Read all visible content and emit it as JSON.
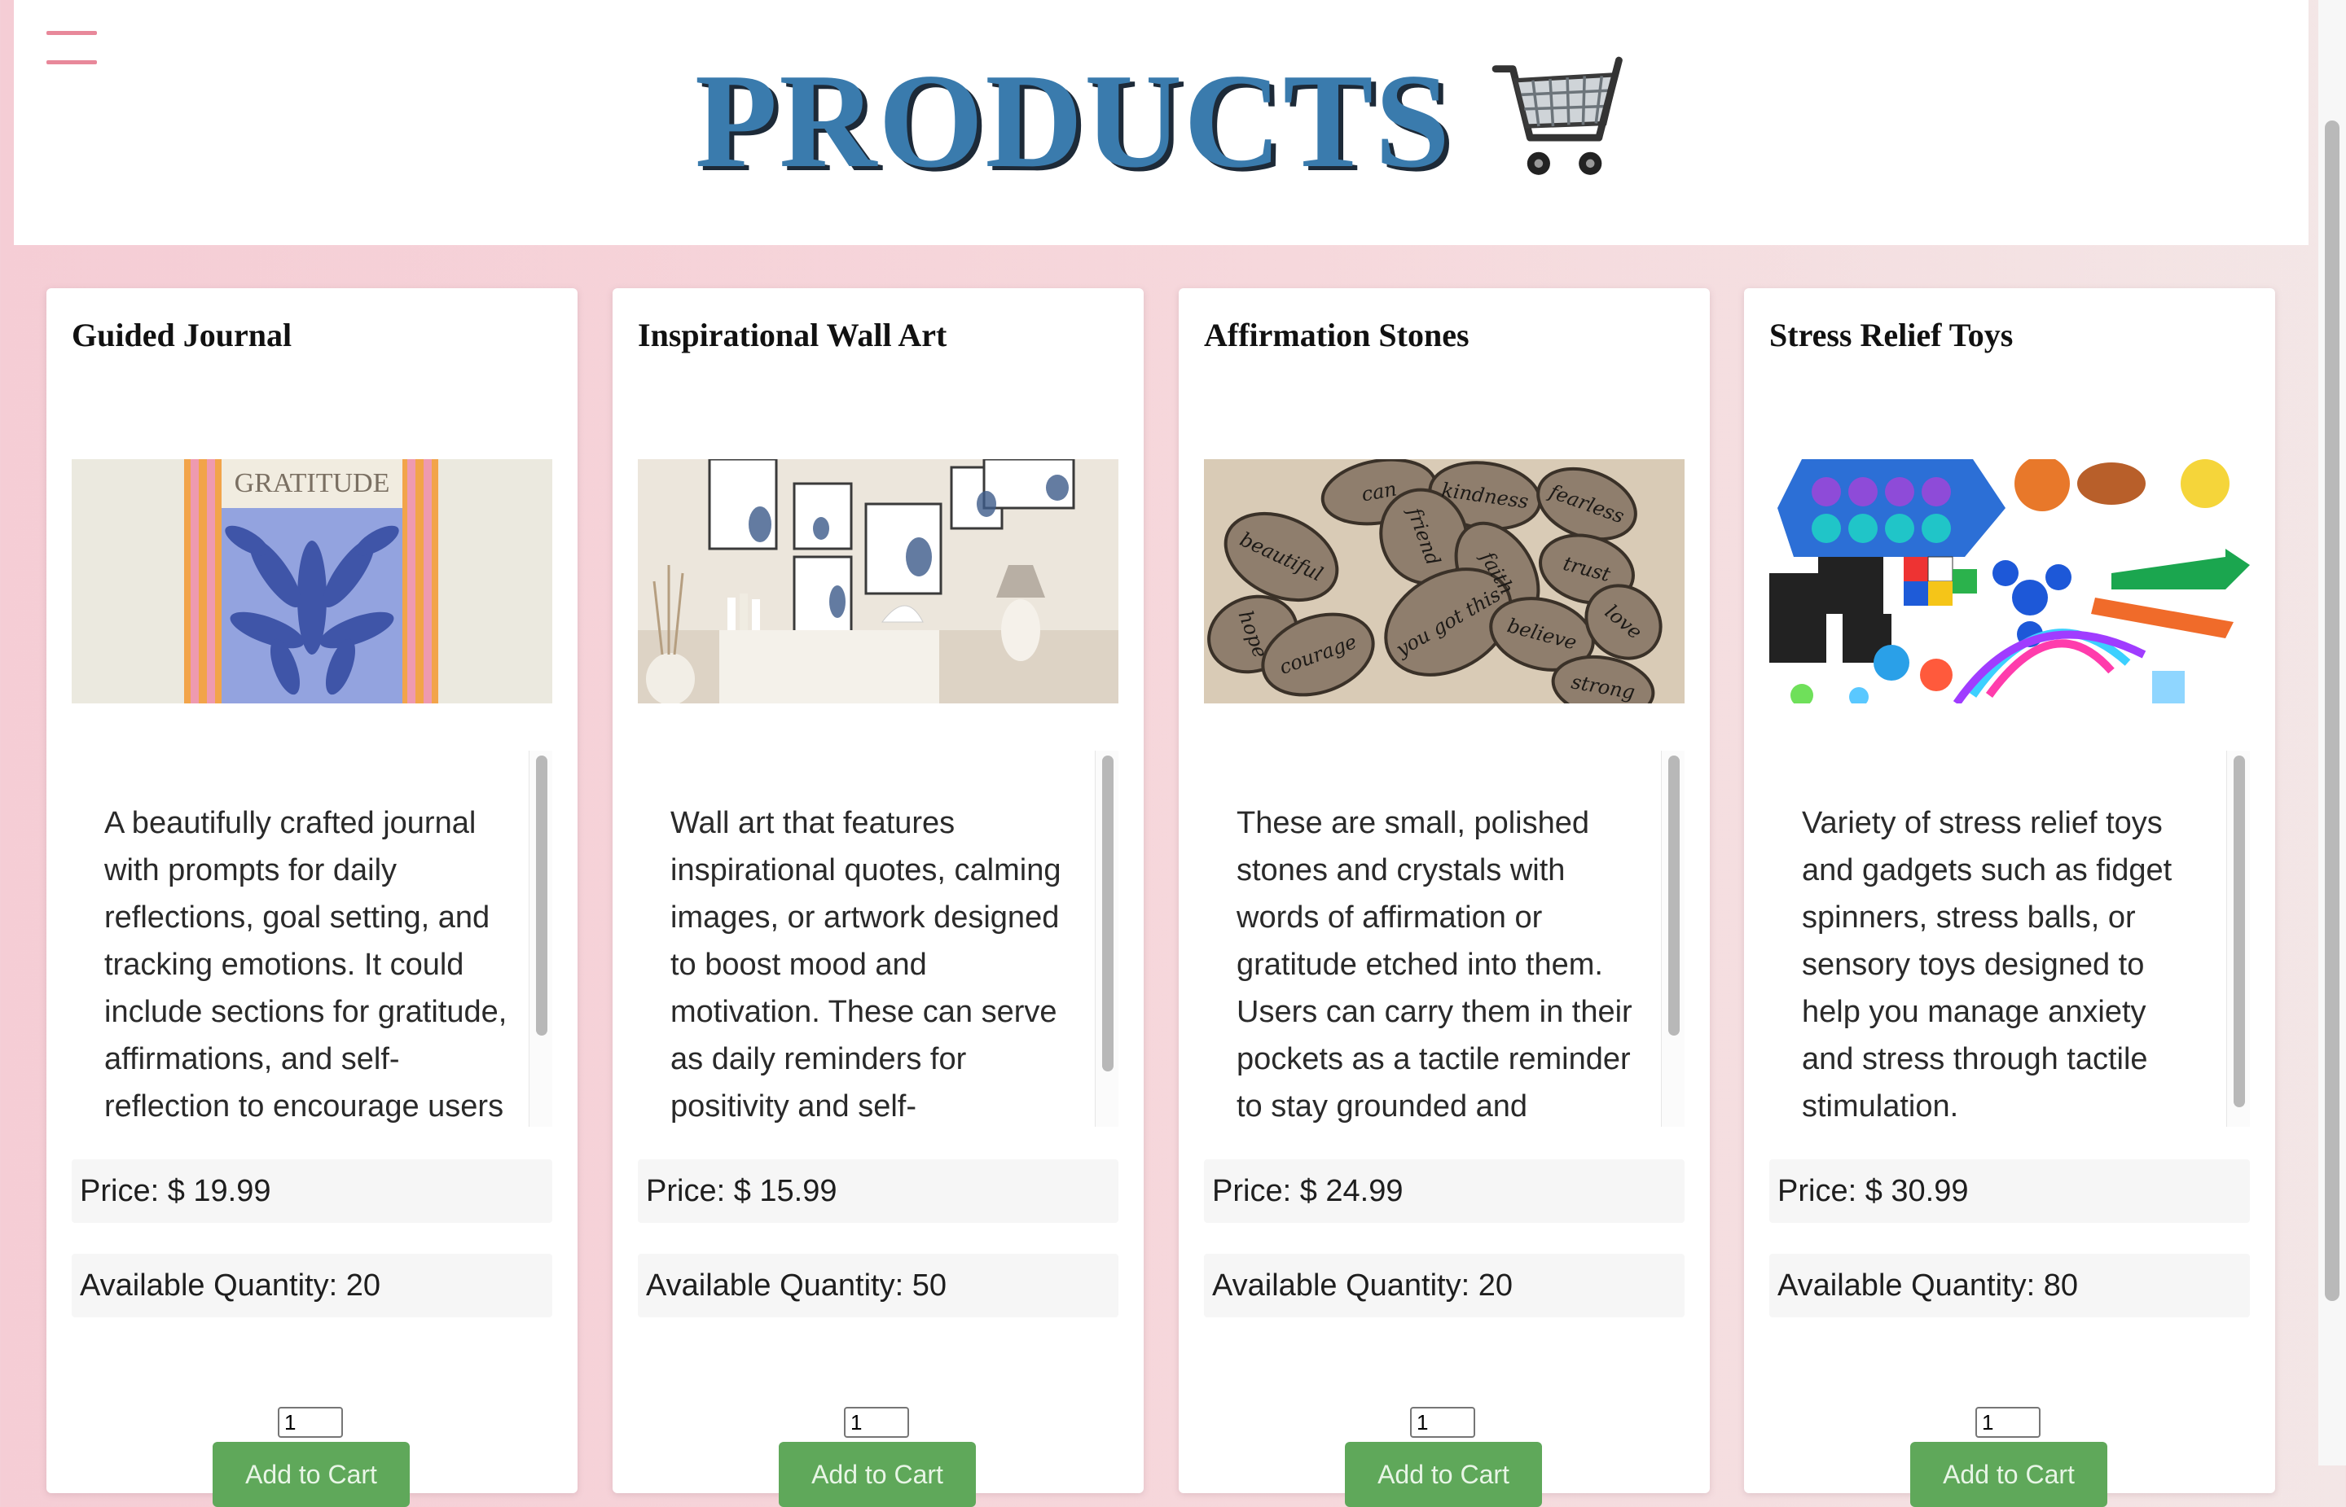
{
  "header": {
    "title": "PRODUCTS",
    "menu_icon": "hamburger-menu-icon",
    "cart_icon": "shopping-cart-icon"
  },
  "labels": {
    "price_prefix": "Price: $ ",
    "quantity_prefix": "Available Quantity: ",
    "add_to_cart": "Add to Cart"
  },
  "products": [
    {
      "name": "Guided Journal",
      "image": "gratitude-journal-cover",
      "image_text": "GRATITUDE",
      "description": "A beautifully crafted journal with prompts for daily reflections, goal setting, and tracking emotions. It could include sections for gratitude, affirmations, and self-reflection to encourage users to explore their",
      "price": "19.99",
      "quantity": "20",
      "order_qty": "1"
    },
    {
      "name": "Inspirational Wall Art",
      "image": "wall-art-gallery",
      "description": "Wall art that features inspirational quotes, calming images, or artwork designed to boost mood and motivation. These can serve as daily reminders for positivity and self-compassion.",
      "price": "15.99",
      "quantity": "50",
      "order_qty": "1"
    },
    {
      "name": "Affirmation Stones",
      "image": "engraved-affirmation-stones",
      "stone_words": [
        "can",
        "kindness",
        "fearless",
        "beautiful",
        "friend",
        "faith",
        "trust",
        "hope",
        "you got this",
        "believe",
        "love",
        "courage",
        "strong"
      ],
      "description": "These are small, polished stones and crystals with words of affirmation or gratitude etched into them. Users can carry them in their pockets as a tactile reminder to stay grounded and focused on positive",
      "price": "24.99",
      "quantity": "20",
      "order_qty": "1"
    },
    {
      "name": "Stress Relief Toys",
      "image": "fidget-toys-collection",
      "description": "Variety of stress relief toys and gadgets such as fidget spinners, stress balls, or sensory toys designed to help you manage anxiety and stress through tactile stimulation.",
      "price": "30.99",
      "quantity": "80",
      "order_qty": "1"
    }
  ]
}
